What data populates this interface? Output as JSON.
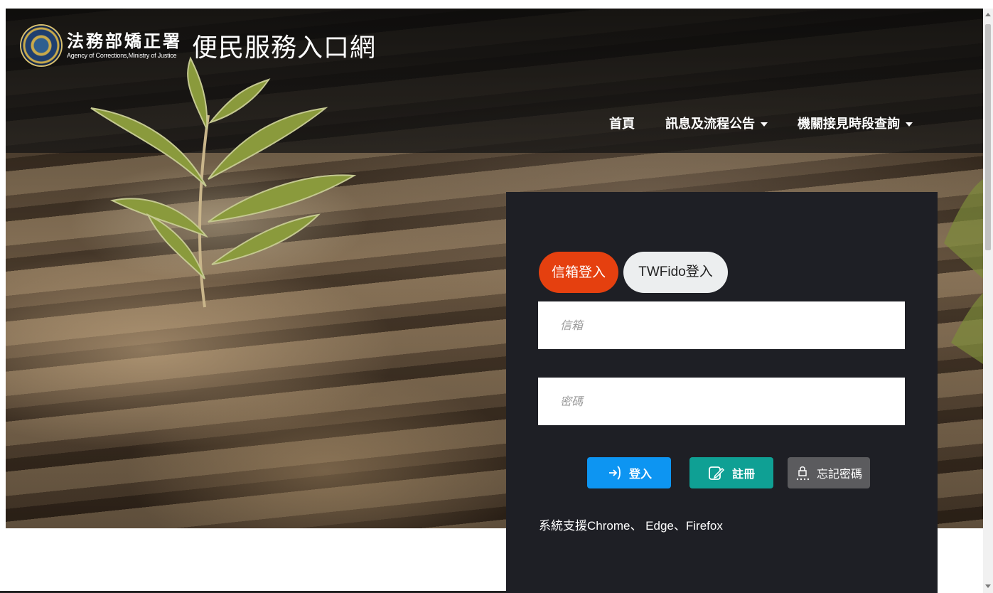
{
  "header": {
    "agency_zh": "法務部矯正署",
    "agency_en": "Agency of Corrections,Ministry of Justice",
    "portal_title": "便民服務入口網"
  },
  "nav": {
    "items": [
      {
        "label": "首頁",
        "has_dropdown": false
      },
      {
        "label": "訊息及流程公告",
        "has_dropdown": true
      },
      {
        "label": "機關接見時段查詢",
        "has_dropdown": true
      }
    ]
  },
  "login": {
    "tabs": [
      {
        "label": "信箱登入",
        "active": true
      },
      {
        "label": "TWFido登入",
        "active": false
      }
    ],
    "email_placeholder": "信箱",
    "password_placeholder": "密碼",
    "buttons": {
      "login": "登入",
      "register": "註冊",
      "forgot": "忘記密碼"
    },
    "support_text": "系統支援Chrome、 Edge、Firefox"
  },
  "colors": {
    "active_tab": "#e5400f",
    "login_button": "#0d95f2",
    "register_button": "#0fa094",
    "forgot_button": "#5b5b5e",
    "panel_bg": "#1e1f25"
  },
  "icons": [
    "agency-emblem-icon",
    "login-arrow-icon",
    "register-edit-icon",
    "lock-password-icon",
    "caret-down-icon"
  ]
}
